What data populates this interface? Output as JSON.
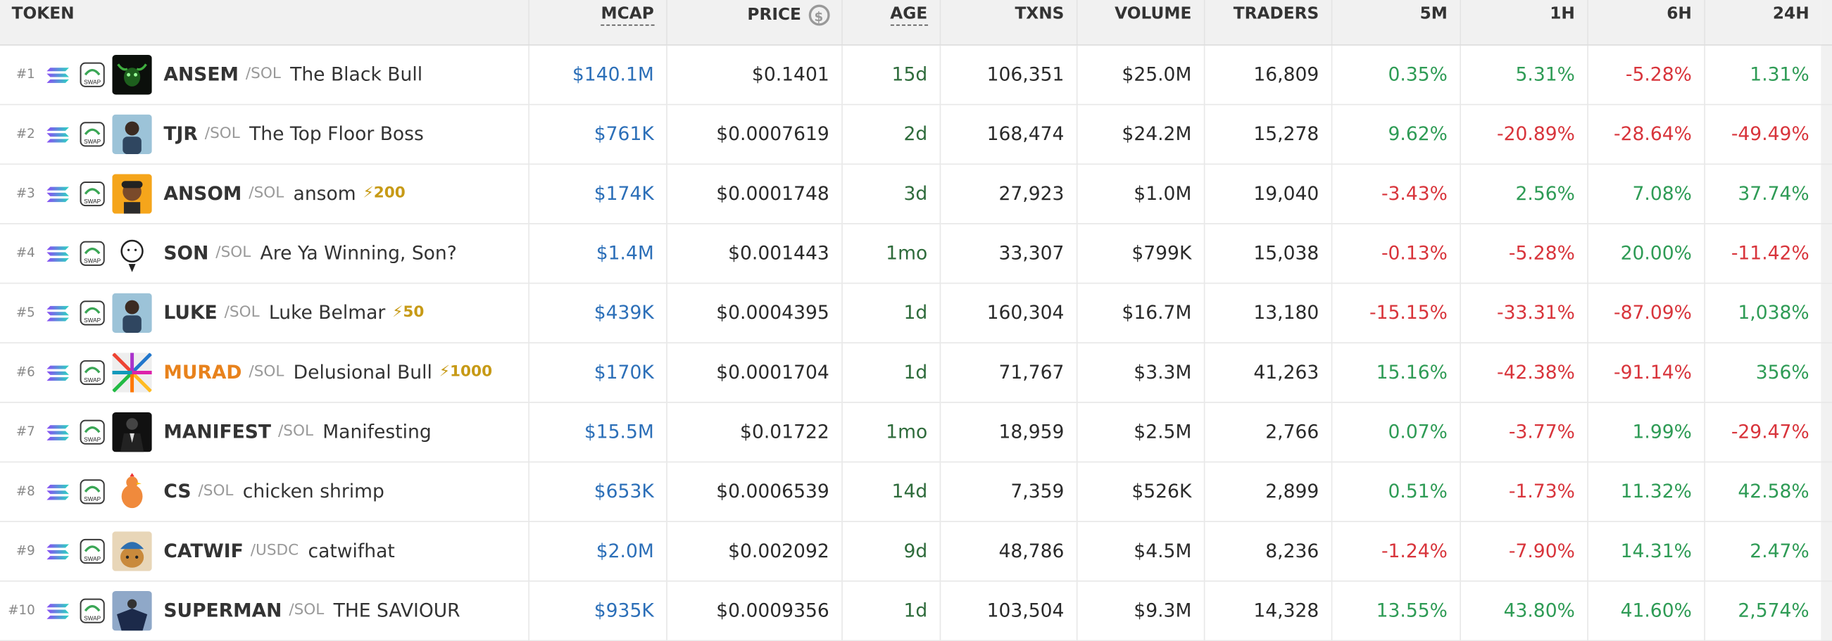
{
  "headers": {
    "token": "TOKEN",
    "mcap": "MCAP",
    "price": "PRICE",
    "age": "AGE",
    "txns": "TXNS",
    "volume": "VOLUME",
    "traders": "TRADERS",
    "m5": "5M",
    "h1": "1H",
    "h6": "6H",
    "h24": "24H"
  },
  "price_icon": "dollar-circle-icon",
  "colors": {
    "mcap": "#2c6fb8",
    "age": "#2e6b3b",
    "positive": "#2e9b55",
    "negative": "#d8343b",
    "boost": "#c79a16",
    "header_bg": "#f1f1f1"
  },
  "rows": [
    {
      "rank": "#1",
      "symbol": "ANSEM",
      "quote": "/SOL",
      "name": "The Black Bull",
      "boost": "",
      "avatar": "bull-avatar",
      "mcap": "$140.1M",
      "price": "$0.1401",
      "age": "15d",
      "txns": "106,351",
      "volume": "$25.0M",
      "traders": "16,809",
      "m5": "0.35%",
      "h1": "5.31%",
      "h6": "-5.28%",
      "h24": "1.31%"
    },
    {
      "rank": "#2",
      "symbol": "TJR",
      "quote": "/SOL",
      "name": "The Top Floor Boss",
      "boost": "",
      "avatar": "person-avatar",
      "mcap": "$761K",
      "price": "$0.0007619",
      "age": "2d",
      "txns": "168,474",
      "volume": "$24.2M",
      "traders": "15,278",
      "m5": "9.62%",
      "h1": "-20.89%",
      "h6": "-28.64%",
      "h24": "-49.49%"
    },
    {
      "rank": "#3",
      "symbol": "ANSOM",
      "quote": "/SOL",
      "name": "ansom",
      "boost": "⚡200",
      "avatar": "cartoon-avatar",
      "mcap": "$174K",
      "price": "$0.0001748",
      "age": "3d",
      "txns": "27,923",
      "volume": "$1.0M",
      "traders": "19,040",
      "m5": "-3.43%",
      "h1": "2.56%",
      "h6": "7.08%",
      "h24": "37.74%"
    },
    {
      "rank": "#4",
      "symbol": "SON",
      "quote": "/SOL",
      "name": "Are Ya Winning, Son?",
      "boost": "",
      "avatar": "meme-face-avatar",
      "mcap": "$1.4M",
      "price": "$0.001443",
      "age": "1mo",
      "txns": "33,307",
      "volume": "$799K",
      "traders": "15,038",
      "m5": "-0.13%",
      "h1": "-5.28%",
      "h6": "20.00%",
      "h24": "-11.42%"
    },
    {
      "rank": "#5",
      "symbol": "LUKE",
      "quote": "/SOL",
      "name": "Luke Belmar",
      "boost": "⚡50",
      "avatar": "person-avatar",
      "mcap": "$439K",
      "price": "$0.0004395",
      "age": "1d",
      "txns": "160,304",
      "volume": "$16.7M",
      "traders": "13,180",
      "m5": "-15.15%",
      "h1": "-33.31%",
      "h6": "-87.09%",
      "h24": "1,038%"
    },
    {
      "rank": "#6",
      "symbol": "MURAD",
      "quote": "/SOL",
      "name": "Delusional Bull",
      "boost": "⚡1000",
      "avatar": "rays-avatar",
      "mcap": "$170K",
      "price": "$0.0001704",
      "age": "1d",
      "txns": "71,767",
      "volume": "$3.3M",
      "traders": "41,263",
      "m5": "15.16%",
      "h1": "-42.38%",
      "h6": "-91.14%",
      "h24": "356%"
    },
    {
      "rank": "#7",
      "symbol": "MANIFEST",
      "quote": "/SOL",
      "name": "Manifesting",
      "boost": "",
      "avatar": "suit-avatar",
      "mcap": "$15.5M",
      "price": "$0.01722",
      "age": "1mo",
      "txns": "18,959",
      "volume": "$2.5M",
      "traders": "2,766",
      "m5": "0.07%",
      "h1": "-3.77%",
      "h6": "1.99%",
      "h24": "-29.47%"
    },
    {
      "rank": "#8",
      "symbol": "CS",
      "quote": "/SOL",
      "name": "chicken shrimp",
      "boost": "",
      "avatar": "chicken-avatar",
      "mcap": "$653K",
      "price": "$0.0006539",
      "age": "14d",
      "txns": "7,359",
      "volume": "$526K",
      "traders": "2,899",
      "m5": "0.51%",
      "h1": "-1.73%",
      "h6": "11.32%",
      "h24": "42.58%"
    },
    {
      "rank": "#9",
      "symbol": "CATWIF",
      "quote": "/USDC",
      "name": "catwifhat",
      "boost": "",
      "avatar": "cat-avatar",
      "mcap": "$2.0M",
      "price": "$0.002092",
      "age": "9d",
      "txns": "48,786",
      "volume": "$4.5M",
      "traders": "8,236",
      "m5": "-1.24%",
      "h1": "-7.90%",
      "h6": "14.31%",
      "h24": "2.47%"
    },
    {
      "rank": "#10",
      "symbol": "SUPERMAN",
      "quote": "/SOL",
      "name": "THE SAVIOUR",
      "boost": "",
      "avatar": "hero-avatar",
      "mcap": "$935K",
      "price": "$0.0009356",
      "age": "1d",
      "txns": "103,504",
      "volume": "$9.3M",
      "traders": "14,328",
      "m5": "13.55%",
      "h1": "43.80%",
      "h6": "41.60%",
      "h24": "2,574%"
    }
  ]
}
